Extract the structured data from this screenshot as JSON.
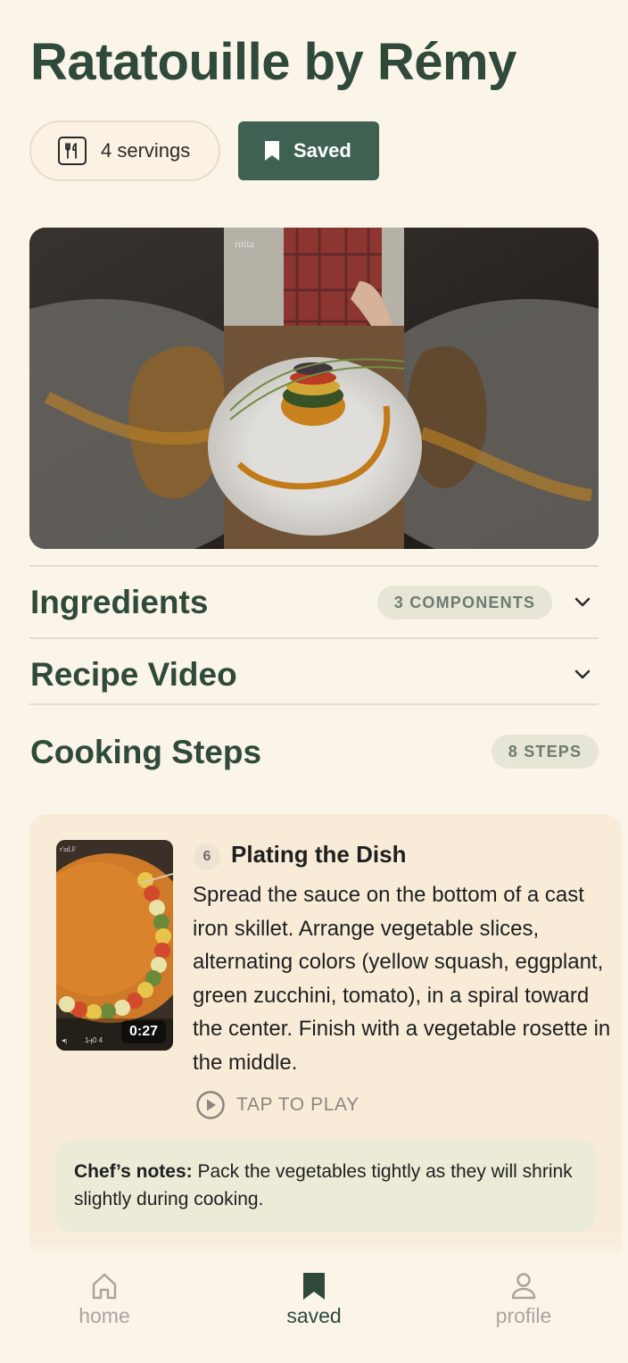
{
  "recipe": {
    "title": "Ratatouille by Rémy",
    "servings_label": "4 servings",
    "saved_label": "Saved"
  },
  "hero": {
    "watermark": "rnita"
  },
  "sections": {
    "ingredients": {
      "title": "Ingredients",
      "badge": "3 COMPONENTS"
    },
    "video": {
      "title": "Recipe Video"
    },
    "steps": {
      "title": "Cooking Steps",
      "badge": "8 STEPS"
    }
  },
  "step": {
    "number": "6",
    "title": "Plating the Dish",
    "body": "Spread the sauce on the bottom of a cast iron skillet. Arrange vegetable slices, alternating colors (yellow squash, eggplant, green zucchini, tomato), in a spiral toward the center. Finish with a vegetable rosette in the middle.",
    "duration": "0:27",
    "tap_to_play": "TAP TO PLAY",
    "notes_label": "Chef’s notes:",
    "notes_text": " Pack the vegetables tightly as they will shrink slightly during cooking."
  },
  "nav": {
    "home": "home",
    "saved": "saved",
    "profile": "profile"
  },
  "colors": {
    "background": "#fbf4e8",
    "brand_green": "#3f6152",
    "title_green": "#2f4a3a",
    "card": "#f8ecd9",
    "notes_bg": "#ecebd8",
    "inactive": "#a9a59e"
  }
}
